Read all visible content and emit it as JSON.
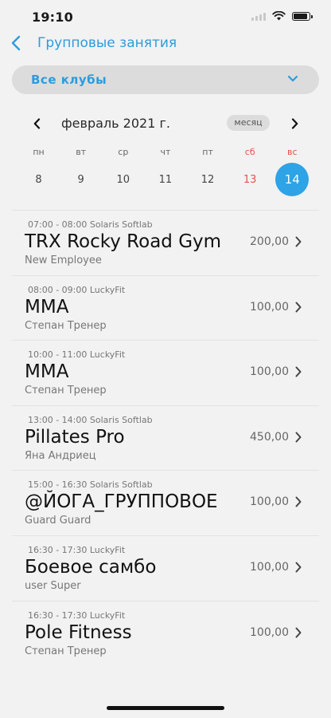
{
  "status_bar": {
    "time": "19:10",
    "icons": [
      "signal-icon",
      "wifi-icon",
      "battery-icon"
    ],
    "battery_level": 0.9
  },
  "header": {
    "back_icon": "chevron-left-icon",
    "title": "Групповые занятия"
  },
  "club_filter": {
    "label": "Все клубы",
    "icon": "chevron-down-icon"
  },
  "calendar": {
    "month_label": "февраль 2021 г.",
    "period_toggle": "месяц",
    "weekday_labels": [
      "пн",
      "вт",
      "ср",
      "чт",
      "пт",
      "сб",
      "вс"
    ],
    "days": [
      "8",
      "9",
      "10",
      "11",
      "12",
      "13",
      "14"
    ],
    "selected_day": "14"
  },
  "sessions": [
    {
      "meta": "07:00 - 08:00 Solaris Softlab",
      "title": "TRX Rocky Road Gym",
      "trainer": "New Employee",
      "price": "200,00"
    },
    {
      "meta": "08:00 - 09:00 LuckyFit",
      "title": "MMA",
      "trainer": "Степан Тренер",
      "price": "100,00"
    },
    {
      "meta": "10:00 - 11:00 LuckyFit",
      "title": "MMA",
      "trainer": "Степан Тренер",
      "price": "100,00"
    },
    {
      "meta": "13:00 - 14:00 Solaris Softlab",
      "title": "Pillates Pro",
      "trainer": "Яна Андриец",
      "price": "450,00"
    },
    {
      "meta": "15:00 - 16:30 Solaris Softlab",
      "title": "@ЙОГА_ГРУППОВОЕ",
      "trainer": "Guard Guard",
      "price": "100,00"
    },
    {
      "meta": "16:30 - 17:30 LuckyFit",
      "title": "Боевое самбо",
      "trainer": "user Super",
      "price": "100,00"
    },
    {
      "meta": "16:30 - 17:30 LuckyFit",
      "title": "Pole Fitness",
      "trainer": "Степан Тренер",
      "price": "100,00"
    }
  ],
  "colors": {
    "accent": "#2d9cdb",
    "selected_day": "#2ea3e6",
    "weekend": "#e5534b",
    "background": "#f2f2f2"
  }
}
